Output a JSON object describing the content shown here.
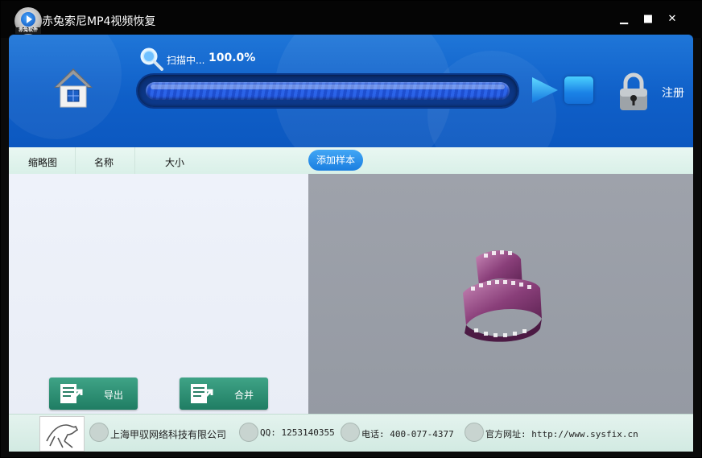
{
  "titlebar": {
    "title": "赤兔索尼MP4视频恢复",
    "logo_tag": "赤兔软件",
    "minimize_label": "▁",
    "maximize_label": "■",
    "close_label": "✕"
  },
  "header": {
    "scan_label": "扫描中...",
    "scan_percent": "100.0%",
    "progress_fraction": 1.0,
    "register_label": "注册"
  },
  "tabs": {
    "thumbnail": "缩略图",
    "name": "名称",
    "size": "大小",
    "add_sample": "添加样本"
  },
  "actions": {
    "export": "导出",
    "merge": "合并"
  },
  "footer": {
    "company": "上海甲驭网络科技有限公司",
    "qq": "QQ: 1253140355",
    "phone": "电话: 400-077-4377",
    "website": "官方网址: http://www.sysfix.cn"
  },
  "colors": {
    "header_blue": "#1565d0",
    "accent_green": "#2e8f74",
    "tab_bg": "#dff3ec"
  }
}
